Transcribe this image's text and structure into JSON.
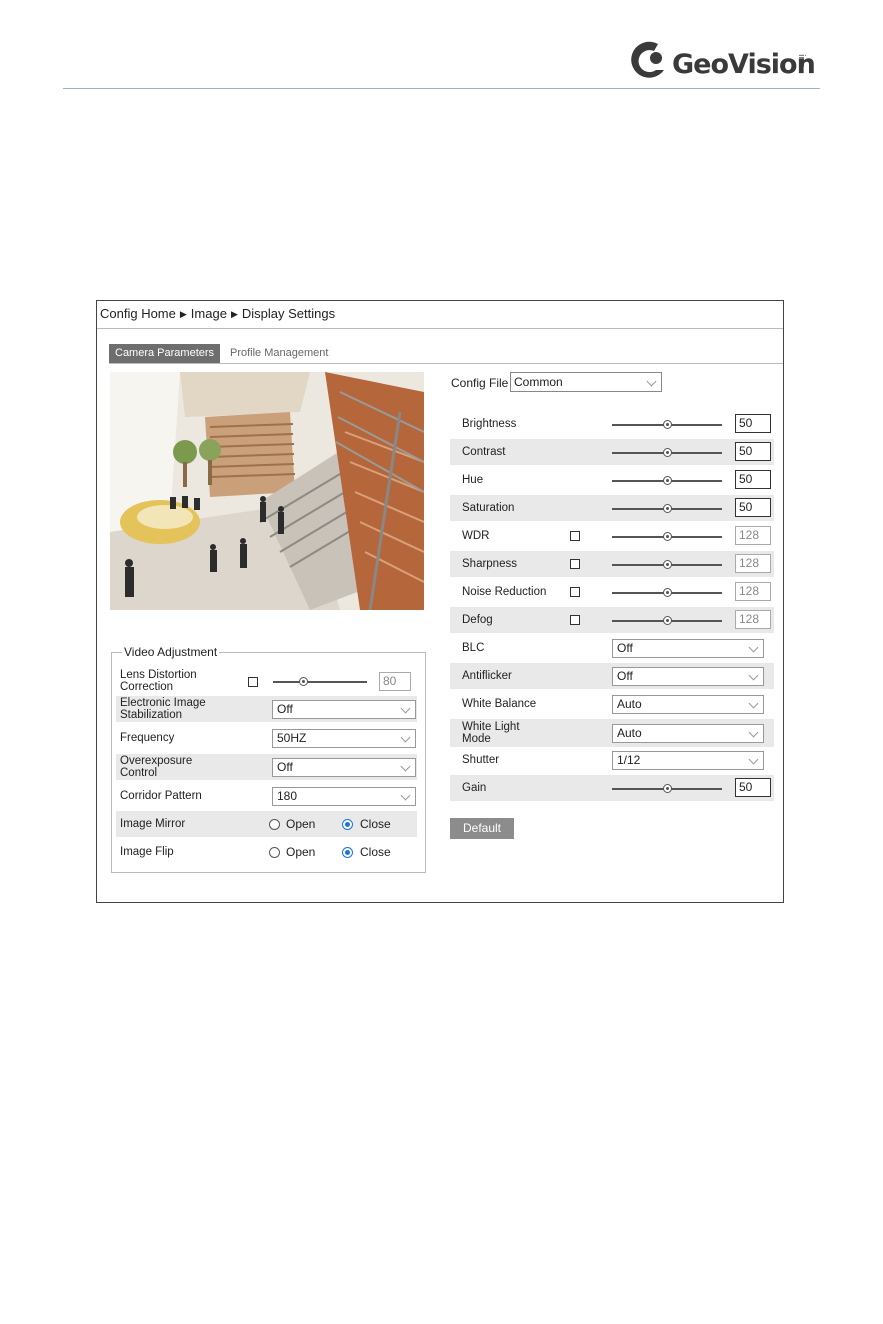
{
  "brand": {
    "name": "GeoVision",
    "suffix": "inc"
  },
  "breadcrumb": {
    "home": "Config Home",
    "section": "Image",
    "page": "Display Settings"
  },
  "tabs": {
    "active": "Camera Parameters",
    "other": "Profile Management"
  },
  "video_adjustment": {
    "legend": "Video Adjustment",
    "lens_distortion": {
      "label_line1": "Lens Distortion",
      "label_line2": "Correction",
      "value": "80",
      "level": 0.32
    },
    "eis": {
      "label_line1": "Electronic Image",
      "label_line2": "Stabilization",
      "value": "Off"
    },
    "frequency": {
      "label": "Frequency",
      "value": "50HZ"
    },
    "overexposure": {
      "label_line1": "Overexposure",
      "label_line2": "Control",
      "value": "Off"
    },
    "corridor": {
      "label": "Corridor Pattern",
      "value": "180"
    },
    "mirror": {
      "label": "Image Mirror",
      "open": "Open",
      "close": "Close"
    },
    "flip": {
      "label": "Image Flip",
      "open": "Open",
      "close": "Close"
    }
  },
  "config_file": {
    "label": "Config File",
    "value": "Common"
  },
  "params": {
    "brightness": {
      "label": "Brightness",
      "value": "50",
      "level": 0.5
    },
    "contrast": {
      "label": "Contrast",
      "value": "50",
      "level": 0.5
    },
    "hue": {
      "label": "Hue",
      "value": "50",
      "level": 0.5
    },
    "saturation": {
      "label": "Saturation",
      "value": "50",
      "level": 0.5
    },
    "wdr": {
      "label": "WDR",
      "value": "128",
      "level": 0.5
    },
    "sharpness": {
      "label": "Sharpness",
      "value": "128",
      "level": 0.5
    },
    "noise": {
      "label": "Noise Reduction",
      "value": "128",
      "level": 0.5
    },
    "defog": {
      "label": "Defog",
      "value": "128",
      "level": 0.5
    },
    "blc": {
      "label": "BLC",
      "value": "Off"
    },
    "antiflicker": {
      "label": "Antiflicker",
      "value": "Off"
    },
    "white_balance": {
      "label": "White Balance",
      "value": "Auto"
    },
    "white_light": {
      "label_line1": "White Light",
      "label_line2": "Mode",
      "value": "Auto"
    },
    "shutter": {
      "label": "Shutter",
      "value": "1/12"
    },
    "gain": {
      "label": "Gain",
      "value": "50",
      "level": 0.5
    }
  },
  "default_button": "Default",
  "colors": {
    "accent_radio": "#1a73e8",
    "tab_active_bg": "#6e6e6e",
    "default_btn_bg": "#8c8c8c",
    "row_shade": "#e9e9e9"
  }
}
